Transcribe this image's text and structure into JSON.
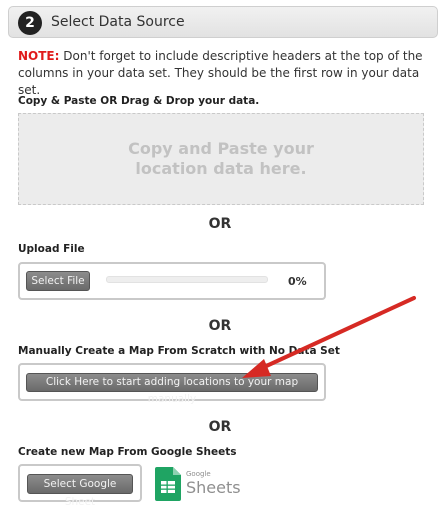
{
  "header": {
    "step": "2",
    "title": "Select Data Source"
  },
  "note": {
    "prefix": "NOTE:",
    "text": " Don't forget to include descriptive headers at the top of the columns in your data set. They should be the first row in your data set."
  },
  "paste": {
    "label": "Copy & Paste OR Drag & Drop your data.",
    "placeholder": "Copy and Paste your location data here."
  },
  "or_text": "OR",
  "upload": {
    "label": "Upload File",
    "button": "Select File",
    "progress_percent": "0%",
    "progress_value": 0
  },
  "manual": {
    "label": "Manually Create a Map From Scratch with No Data Set",
    "button": "Click Here to start adding locations to your map manually"
  },
  "google": {
    "label": "Create new Map From Google Sheets",
    "button": "Select Google Sheet",
    "logo_small": "Google",
    "logo_big": "Sheets"
  },
  "colors": {
    "note_red": "#e01b1b",
    "arrow_red": "#d62a24",
    "sheets_green": "#1fa463"
  }
}
